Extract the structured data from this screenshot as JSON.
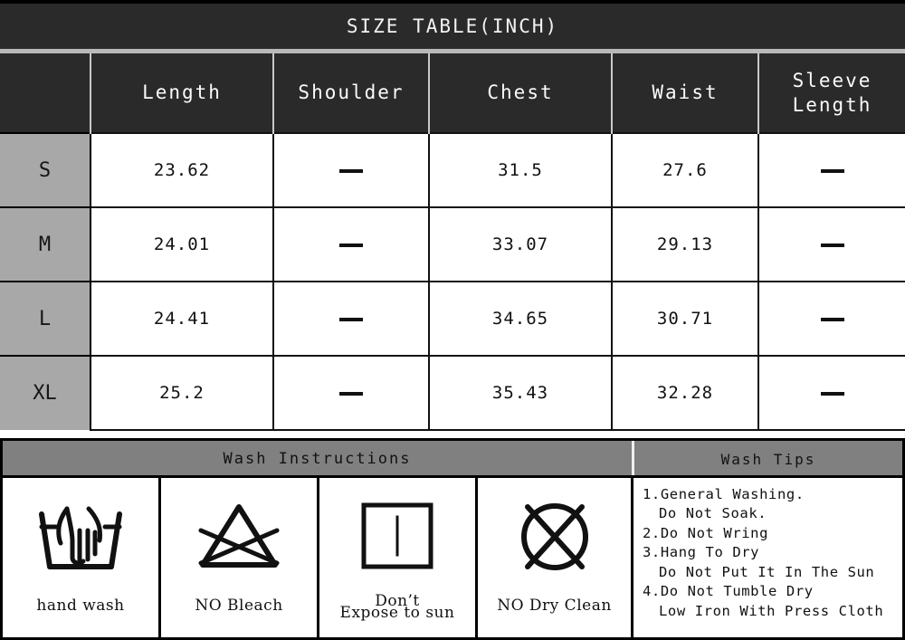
{
  "size_table": {
    "title": "SIZE TABLE(INCH)",
    "columns": [
      "",
      "Length",
      "Shoulder",
      "Chest",
      "Waist",
      "Sleeve Length"
    ],
    "column_labels": {
      "corner": "",
      "length": "Length",
      "shoulder": "Shoulder",
      "chest": "Chest",
      "waist": "Waist",
      "sleeve_line1": "Sleeve",
      "sleeve_line2": "Length"
    },
    "rows": [
      {
        "size": "S",
        "length": "23.62",
        "shoulder": "—",
        "chest": "31.5",
        "waist": "27.6",
        "sleeve": "—"
      },
      {
        "size": "M",
        "length": "24.01",
        "shoulder": "—",
        "chest": "33.07",
        "waist": "29.13",
        "sleeve": "—"
      },
      {
        "size": "L",
        "length": "24.41",
        "shoulder": "—",
        "chest": "34.65",
        "waist": "30.71",
        "sleeve": "—"
      },
      {
        "size": "XL",
        "length": "25.2",
        "shoulder": "—",
        "chest": "35.43",
        "waist": "32.28",
        "sleeve": "—"
      }
    ]
  },
  "wash": {
    "header_left": "Wash Instructions",
    "header_right": "Wash Tips",
    "symbols": [
      {
        "icon": "hand-wash-icon",
        "label_line1": "hand wash",
        "label_line2": ""
      },
      {
        "icon": "no-bleach-icon",
        "label_line1": "NO Bleach",
        "label_line2": ""
      },
      {
        "icon": "dry-in-shade-icon",
        "label_line1": "Don’t",
        "label_line2": "Expose to sun"
      },
      {
        "icon": "no-dry-clean-icon",
        "label_line1": "NO Dry Clean",
        "label_line2": ""
      }
    ],
    "tips": [
      "1.General Washing.",
      "  Do Not Soak.",
      "2.Do Not Wring",
      "3.Hang To Dry",
      "  Do Not Put It In The Sun",
      "4.Do Not Tumble Dry",
      "  Low Iron With Press Cloth"
    ]
  },
  "colors": {
    "header_dark": "#2a2a2a",
    "size_col_gray": "#a8a8a8",
    "wash_header_gray": "#808080",
    "cell_white": "#ffffff",
    "line_black": "#111111"
  }
}
